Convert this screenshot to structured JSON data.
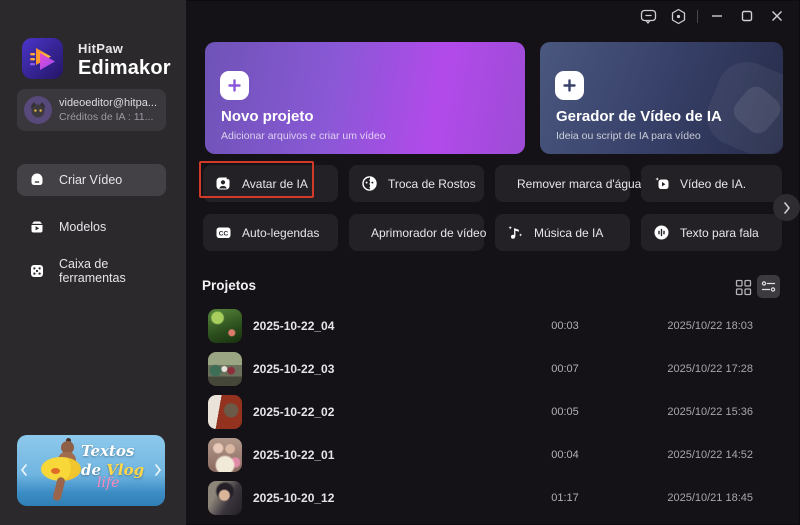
{
  "brand": {
    "name": "HitPaw",
    "product": "Edimakor"
  },
  "account": {
    "email": "videoeditor@hitpa...",
    "credits": "Créditos de IA : 11..."
  },
  "sidebar": {
    "items": [
      {
        "label": "Criar Vídeo",
        "icon": "create-video-icon",
        "active": true
      },
      {
        "label": "Modelos",
        "icon": "templates-icon",
        "active": false
      },
      {
        "label": "Caixa de ferramentas",
        "icon": "toolbox-icon",
        "active": false
      }
    ]
  },
  "banner": {
    "word1": "Textos",
    "word2_prefix": "de ",
    "word2_highlight": "Vlog",
    "script_word": "life",
    "colors": {
      "highlight": "#ffd84a",
      "script": "#ff85b8"
    }
  },
  "titlebar": {
    "icons": [
      "feedback-icon",
      "settings-icon",
      "minimize",
      "maximize",
      "close"
    ]
  },
  "cards": [
    {
      "title": "Novo projeto",
      "subtitle": "Adicionar arquivos e criar um vídeo",
      "icon": "plus-icon"
    },
    {
      "title": "Gerador de Vídeo de IA",
      "subtitle": "Ideia ou script de IA para vídeo",
      "icon": "plus-icon"
    }
  ],
  "features": [
    {
      "label": "Avatar de IA",
      "icon": "ai-avatar-icon",
      "highlighted": true
    },
    {
      "label": "Troca de Rostos",
      "icon": "face-swap-icon"
    },
    {
      "label": "Remover marca d'água",
      "icon": "watermark-remover-icon"
    },
    {
      "label": "Vídeo de IA.",
      "icon": "ai-video-icon"
    },
    {
      "label": "Auto-legendas",
      "icon": "auto-captions-icon",
      "icon_text": "CC"
    },
    {
      "label": "Aprimorador de vídeo",
      "icon": "video-enhancer-icon"
    },
    {
      "label": "Música de IA",
      "icon": "ai-music-icon"
    },
    {
      "label": "Texto para fala",
      "icon": "text-to-speech-icon"
    }
  ],
  "projects": {
    "title": "Projetos",
    "view_icons": [
      "grid-view-icon",
      "list-view-icon"
    ],
    "rows": [
      {
        "name": "2025-10-22_04",
        "duration": "00:03",
        "date": "2025/10/22 18:03",
        "thumbnail": "forest-scene"
      },
      {
        "name": "2025-10-22_03",
        "duration": "00:07",
        "date": "2025/10/22 17:28",
        "thumbnail": "wedding-group"
      },
      {
        "name": "2025-10-22_02",
        "duration": "00:05",
        "date": "2025/10/22 15:36",
        "thumbnail": "portrait-red"
      },
      {
        "name": "2025-10-22_01",
        "duration": "00:04",
        "date": "2025/10/22 14:52",
        "thumbnail": "friends-group"
      },
      {
        "name": "2025-10-20_12",
        "duration": "01:17",
        "date": "2025/10/21 18:45",
        "thumbnail": "woman-portrait"
      }
    ]
  },
  "colors": {
    "sidebar_bg": "#2b292c",
    "main_bg": "#141216",
    "card_new_project_accent": "#b24aea",
    "card_ai_generator_accent": "#3c4a74",
    "annotation_red": "#d23a28",
    "button_bg": "#232126"
  }
}
